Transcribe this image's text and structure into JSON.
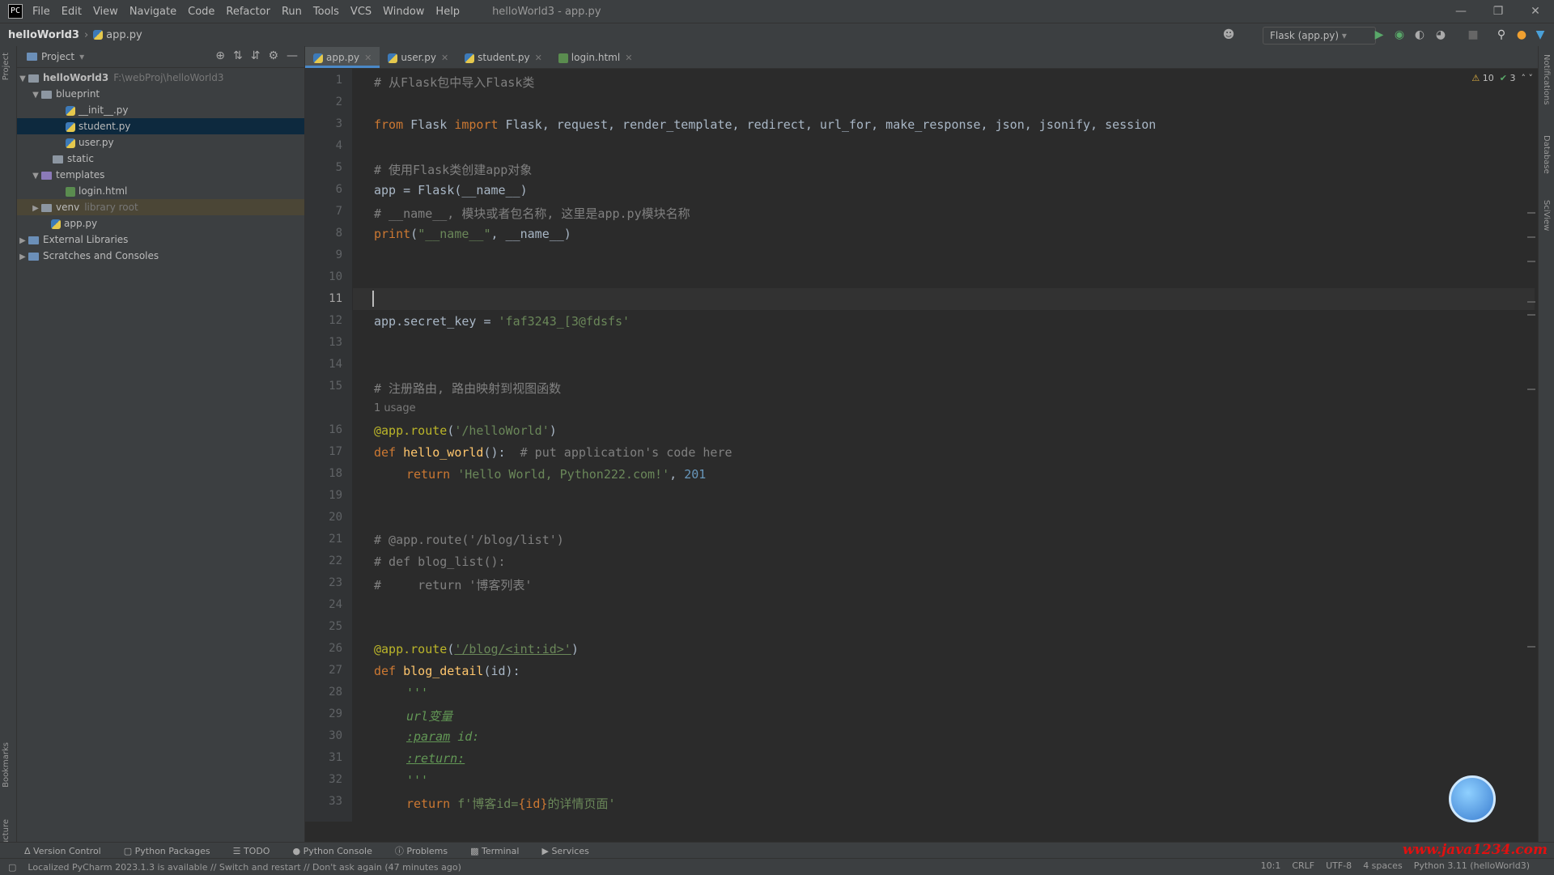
{
  "menu": {
    "items": [
      "File",
      "Edit",
      "View",
      "Navigate",
      "Code",
      "Refactor",
      "Run",
      "Tools",
      "VCS",
      "Window",
      "Help"
    ],
    "window_title": "helloWorld3 - app.py"
  },
  "navbar": {
    "project": "helloWorld3",
    "file": "app.py"
  },
  "run_config": "Flask (app.py)",
  "project_panel": {
    "title": "Project",
    "tree": [
      {
        "label": "helloWorld3",
        "extra": "F:\\webProj\\helloWorld3"
      },
      {
        "label": "blueprint"
      },
      {
        "label": "__init__.py"
      },
      {
        "label": "student.py"
      },
      {
        "label": "user.py"
      },
      {
        "label": "static"
      },
      {
        "label": "templates"
      },
      {
        "label": "login.html"
      },
      {
        "label": "venv",
        "extra": "library root"
      },
      {
        "label": "app.py"
      },
      {
        "label": "External Libraries"
      },
      {
        "label": "Scratches and Consoles"
      }
    ]
  },
  "tabs": [
    "app.py",
    "user.py",
    "student.py",
    "login.html"
  ],
  "inspection_counts": {
    "warnings": "10",
    "ok": "3"
  },
  "code": {
    "line_numbers": [
      "1",
      "2",
      "3",
      "4",
      "5",
      "6",
      "7",
      "8",
      "9",
      "10",
      "11",
      "12",
      "13",
      "14",
      "15",
      "16",
      "17",
      "18",
      "19",
      "20",
      "21",
      "22",
      "23",
      "24",
      "25",
      "26",
      "27",
      "28",
      "29",
      "30",
      "31",
      "32",
      "33"
    ],
    "usage_hint": "1 usage",
    "lines": {
      "l1": "# 从Flask包中导入Flask类",
      "l3_kw1": "from",
      "l3_mod": " Flask ",
      "l3_kw2": "import",
      "l3_rest": " Flask, request, render_template, redirect, url_for, make_response, json, jsonify, session",
      "l5": "# 使用Flask类创建app对象",
      "l6": "app = Flask(__name__)",
      "l7": "# __name__, 模块或者包名称, 这里是app.py模块名称",
      "l8_fn": "print",
      "l8_a": "(",
      "l8_str": "\"__name__\"",
      "l8_b": ", __name__)",
      "l12_a": "app.secret_key = ",
      "l12_str": "'faf3243_[3@fdsfs'",
      "l15": "# 注册路由, 路由映射到视图函数",
      "l16_dec": "@app.route",
      "l16_a": "(",
      "l16_str": "'/helloWorld'",
      "l16_b": ")",
      "l17_kw": "def",
      "l17_fn": " hello_world",
      "l17_a": "():  ",
      "l17_cm": "# put application's code here",
      "l18_kw": "return",
      "l18_str": " 'Hello World, Python222.com!'",
      "l18_a": ", ",
      "l18_num": "201",
      "l21": "# @app.route('/blog/list')",
      "l22": "# def blog_list():",
      "l23": "#     return '博客列表'",
      "l26_dec": "@app.route",
      "l26_a": "(",
      "l26_str": "'/blog/<int:id>'",
      "l26_b": ")",
      "l27_kw": "def",
      "l27_fn": " blog_detail",
      "l27_a": "(id):",
      "l28": "'''",
      "l29": "url变量",
      "l30_tag": ":param",
      "l30_rest": " id:",
      "l31_tag": ":return:",
      "l32": "'''",
      "l33_kw": "return",
      "l33_str_a": " f'博客id=",
      "l33_expr": "{id}",
      "l33_str_b": "的详情页面'"
    }
  },
  "tool_windows": [
    "Version Control",
    "Python Packages",
    "TODO",
    "Python Console",
    "Problems",
    "Terminal",
    "Services"
  ],
  "status": {
    "message": "Localized PyCharm 2023.1.3 is available // Switch and restart // Don't ask again (47 minutes ago)",
    "position": "10:1",
    "line_sep": "CRLF",
    "encoding": "UTF-8",
    "indent": "4 spaces",
    "interpreter": "Python 3.11 (helloWorld3)"
  },
  "watermark": "www.java1234.com",
  "left_stripe": [
    "Project",
    "Bookmarks",
    "Structure"
  ],
  "right_stripe": [
    "Notifications",
    "Database",
    "SciView"
  ]
}
